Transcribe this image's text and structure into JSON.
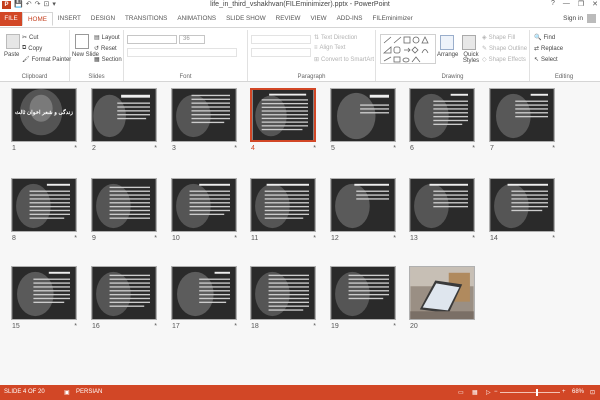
{
  "window": {
    "title": "life_in_third_vshakhvan(FILEminimizer).pptx - PowerPoint",
    "controls": [
      "?",
      "—",
      "❐",
      "✕"
    ]
  },
  "qat": {
    "app_badge": "P",
    "save": "💾",
    "undo": "↶",
    "redo": "↷",
    "start": "⊡",
    "customize": "▾"
  },
  "tabs": [
    {
      "label": "FILE"
    },
    {
      "label": "HOME"
    },
    {
      "label": "INSERT"
    },
    {
      "label": "DESIGN"
    },
    {
      "label": "TRANSITIONS"
    },
    {
      "label": "ANIMATIONS"
    },
    {
      "label": "SLIDE SHOW"
    },
    {
      "label": "REVIEW"
    },
    {
      "label": "VIEW"
    },
    {
      "label": "ADD-INS"
    },
    {
      "label": "FILEminimizer"
    }
  ],
  "active_tab": "HOME",
  "account": {
    "signin": "Sign in"
  },
  "ribbon": {
    "clipboard": {
      "paste": "Paste",
      "cut": "Cut",
      "copy": "Copy",
      "format_painter": "Format Painter",
      "label": "Clipboard"
    },
    "slides": {
      "new_slide": "New Slide",
      "layout": "Layout",
      "reset": "Reset",
      "section": "Section",
      "label": "Slides"
    },
    "font": {
      "size": "36",
      "label": "Font"
    },
    "paragraph": {
      "text_direction": "Text Direction",
      "align_text": "Align Text",
      "smartart": "Convert to SmartArt",
      "label": "Paragraph"
    },
    "drawing": {
      "arrange": "Arrange",
      "quick_styles": "Quick Styles",
      "shape_fill": "Shape Fill",
      "shape_outline": "Shape Outline",
      "shape_effects": "Shape Effects",
      "label": "Drawing"
    },
    "editing": {
      "find": "Find",
      "replace": "Replace",
      "select": "Select",
      "label": "Editing"
    }
  },
  "slides": [
    {
      "n": "1"
    },
    {
      "n": "2"
    },
    {
      "n": "3"
    },
    {
      "n": "4"
    },
    {
      "n": "5"
    },
    {
      "n": "6"
    },
    {
      "n": "7"
    },
    {
      "n": "8"
    },
    {
      "n": "9"
    },
    {
      "n": "10"
    },
    {
      "n": "11"
    },
    {
      "n": "12"
    },
    {
      "n": "13"
    },
    {
      "n": "14"
    },
    {
      "n": "15"
    },
    {
      "n": "16"
    },
    {
      "n": "17"
    },
    {
      "n": "18"
    },
    {
      "n": "19"
    },
    {
      "n": "20"
    }
  ],
  "slide_star": "*",
  "selected_slide": 4,
  "slide1_title": "زندگی و شعر اخوان ثالث",
  "status": {
    "slide_info": "SLIDE 4 OF 20",
    "language": "PERSIAN",
    "zoom": "68%",
    "zoom_minus": "−",
    "zoom_plus": "+"
  },
  "colors": {
    "accent": "#d24726",
    "brand": "#c43e1c"
  }
}
